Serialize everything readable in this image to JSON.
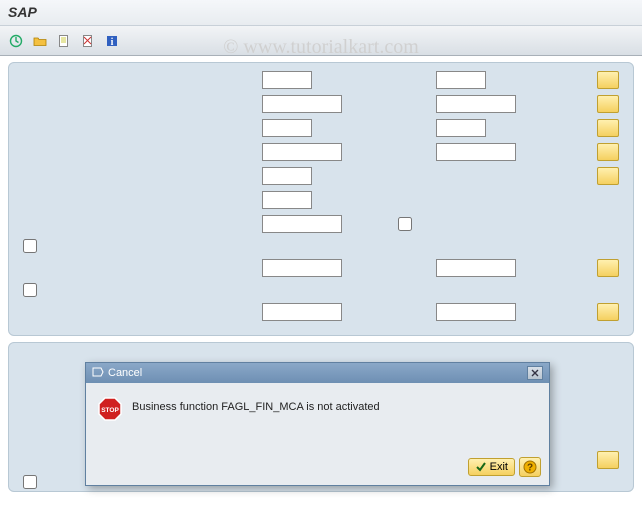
{
  "title": "SAP",
  "watermark": "© www.tutorialkart.com",
  "modal": {
    "title": "Cancel",
    "message": "Business function FAGL_FIN_MCA is not activated",
    "exit_label": "Exit"
  }
}
